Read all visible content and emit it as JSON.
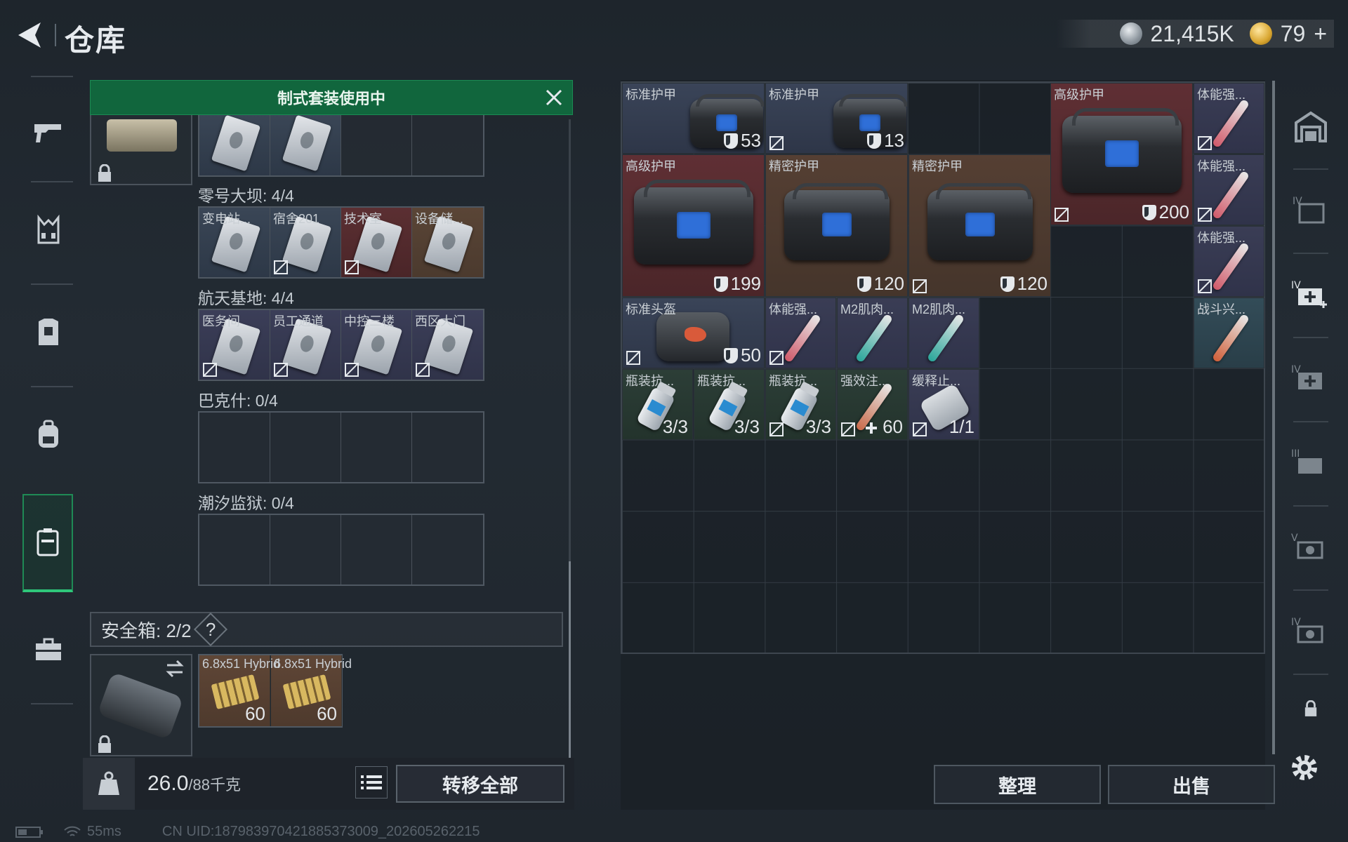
{
  "header": {
    "title": "仓库"
  },
  "currency": {
    "silver": "21,415K",
    "gold": "79",
    "plus": "+"
  },
  "banner": {
    "label": "制式套装使用中"
  },
  "keycard_sections": [
    {
      "label": "",
      "cells": [
        {
          "name": "",
          "rarity": "blue"
        },
        {
          "name": "",
          "rarity": "blue"
        },
        {
          "name": "",
          "rarity": "empty"
        },
        {
          "name": "",
          "rarity": "empty"
        }
      ]
    },
    {
      "label": "零号大坝: 4/4",
      "cells": [
        {
          "name": "变电站...",
          "rarity": "blue"
        },
        {
          "name": "宿舍201",
          "rarity": "blue"
        },
        {
          "name": "技术室",
          "rarity": "red"
        },
        {
          "name": "设备储...",
          "rarity": "brown"
        }
      ]
    },
    {
      "label": "航天基地: 4/4",
      "cells": [
        {
          "name": "医务间",
          "rarity": "purple"
        },
        {
          "name": "员工通道",
          "rarity": "purple"
        },
        {
          "name": "中控三楼",
          "rarity": "purple"
        },
        {
          "name": "西区大门",
          "rarity": "purple"
        }
      ]
    },
    {
      "label": "巴克什: 0/4",
      "cells": []
    },
    {
      "label": "潮汐监狱: 0/4",
      "cells": []
    }
  ],
  "safe_box": {
    "label": "安全箱: 2/2",
    "help": "?",
    "items": [
      {
        "name": "6.8x51 Hybrid",
        "count": "60"
      },
      {
        "name": "6.8x51 Hybrid",
        "count": "60"
      }
    ]
  },
  "footer": {
    "weight": "26.0",
    "capacity": "/88千克",
    "transfer_all": "转移全部"
  },
  "stash_items": [
    {
      "name": "标准护甲",
      "value": "53"
    },
    {
      "name": "标准护甲",
      "value": "13"
    },
    {
      "name": "高级护甲",
      "value": "200"
    },
    {
      "name": "体能强...",
      "value": ""
    },
    {
      "name": "高级护甲",
      "value": "199"
    },
    {
      "name": "精密护甲",
      "value": "120"
    },
    {
      "name": "精密护甲",
      "value": "120"
    },
    {
      "name": "体能强...",
      "value": ""
    },
    {
      "name": "体能强...",
      "value": ""
    },
    {
      "name": "标准头盔",
      "value": "50"
    },
    {
      "name": "体能强...",
      "value": ""
    },
    {
      "name": "M2肌肉...",
      "value": ""
    },
    {
      "name": "M2肌肉...",
      "value": ""
    },
    {
      "name": "战斗兴...",
      "value": ""
    },
    {
      "name": "瓶装抗...",
      "value": "3/3"
    },
    {
      "name": "瓶装抗...",
      "value": "3/3"
    },
    {
      "name": "瓶装抗...",
      "value": "3/3"
    },
    {
      "name": "强效注...",
      "value": "60"
    },
    {
      "name": "缓释止...",
      "value": "1/1"
    }
  ],
  "actions": {
    "sort": "整理",
    "sell": "出售"
  },
  "status": {
    "ping": "55ms",
    "uid": "CN UID:1879839704218853730​09_202605262215"
  },
  "colors": {
    "accent_green": "#11663d",
    "legendary_red": "#5f2f34",
    "epic_brown": "#553f33",
    "rare_blue": "#3a4458"
  }
}
